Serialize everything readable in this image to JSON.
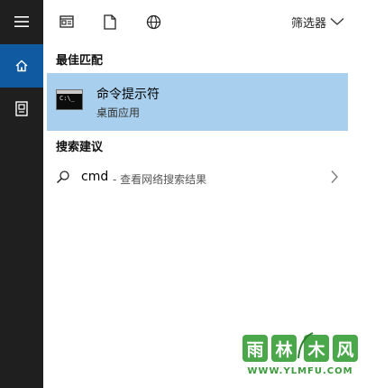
{
  "sidebar": {
    "items": [
      {
        "icon": "hamburger-icon"
      },
      {
        "icon": "home-icon"
      },
      {
        "icon": "document-icon"
      }
    ]
  },
  "toolbar": {
    "icons": [
      "news-icon",
      "file-icon",
      "globe-icon"
    ],
    "filter_label": "筛选器"
  },
  "best_match": {
    "title": "最佳匹配",
    "item_name": "命令提示符",
    "item_type": "桌面应用"
  },
  "suggestions": {
    "title": "搜索建议",
    "items": [
      {
        "query": "cmd",
        "description": "- 查看网络搜索结果"
      }
    ]
  },
  "watermark": {
    "logo_text": "雨林木风",
    "url": "WWW.YLMFU.COM"
  },
  "colors": {
    "rail_bg": "#1f1f1f",
    "rail_active": "#0f5aa0",
    "highlight": "#a8d0ee"
  }
}
